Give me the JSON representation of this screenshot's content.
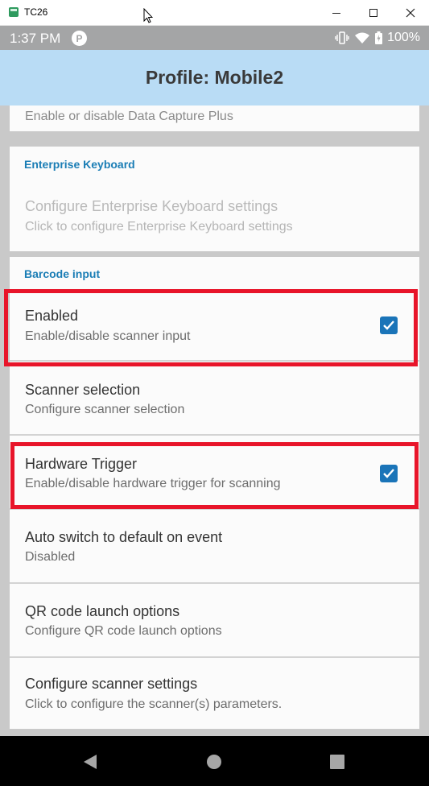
{
  "window": {
    "title": "TC26",
    "app_icon": "tc26-app-icon",
    "controls": [
      "minimize-icon",
      "maximize-icon",
      "close-icon"
    ]
  },
  "status_bar": {
    "time": "1:37 PM",
    "notification_icon": "app-notification-icon",
    "icons": [
      "vibrate-icon",
      "wifi-icon",
      "battery-charging-icon"
    ],
    "battery": "100%"
  },
  "app_bar": {
    "title": "Profile: Mobile2"
  },
  "data_capture_plus": {
    "subtitle": "Enable or disable Data Capture Plus"
  },
  "enterprise_keyboard": {
    "header": "Enterprise Keyboard",
    "item": {
      "title": "Configure Enterprise Keyboard settings",
      "subtitle": "Click to configure Enterprise Keyboard settings"
    }
  },
  "barcode_input": {
    "header": "Barcode input",
    "items": [
      {
        "title": "Enabled",
        "subtitle": "Enable/disable scanner input",
        "checked": true,
        "highlighted": true
      },
      {
        "title": "Scanner selection",
        "subtitle": "Configure scanner selection"
      },
      {
        "title": "Hardware Trigger",
        "subtitle": "Enable/disable hardware trigger for scanning",
        "checked": true,
        "highlighted": true
      },
      {
        "title": "Auto switch to default on event",
        "subtitle": "Disabled"
      },
      {
        "title": "QR code launch options",
        "subtitle": "Configure QR code launch options"
      },
      {
        "title": "Configure scanner settings",
        "subtitle": "Click to configure the scanner(s) parameters."
      }
    ]
  },
  "nav_bar": {
    "buttons": [
      "back-icon",
      "home-icon",
      "recents-icon"
    ]
  },
  "colors": {
    "app_bar": "#b9dcf5",
    "status_bar": "#a4a5a6",
    "accent": "#1a7db5",
    "checkbox": "#1a74b8",
    "highlight": "#e8152a",
    "background": "#c9c9c9"
  }
}
